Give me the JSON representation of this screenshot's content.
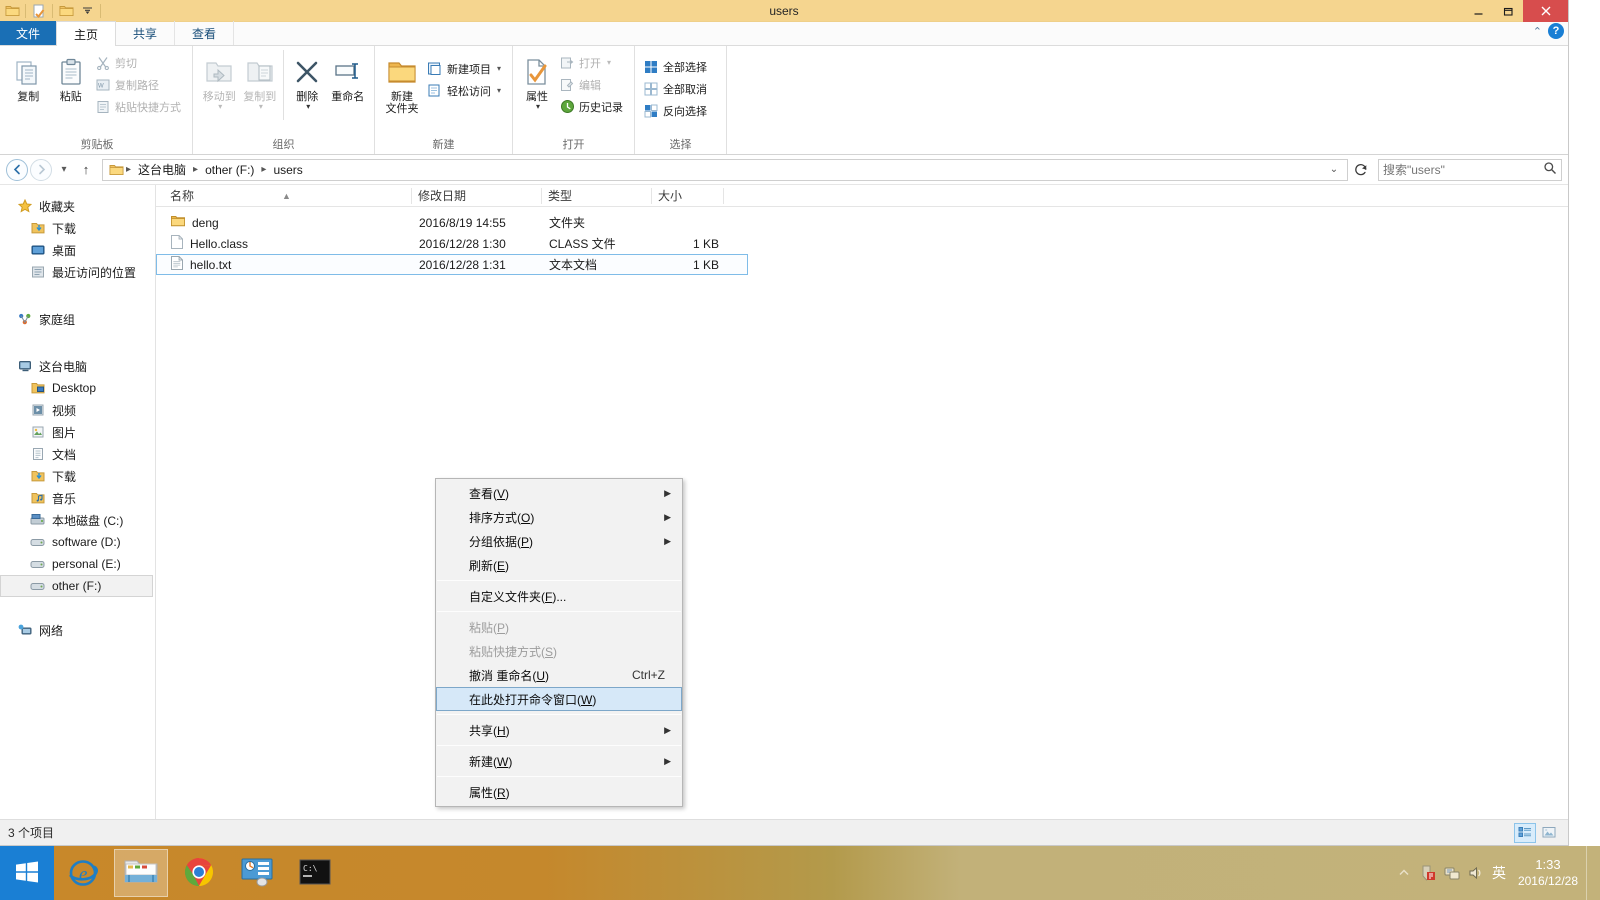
{
  "window": {
    "title": "users",
    "quick_access": [
      "folder-icon",
      "properties-icon",
      "new-folder-icon",
      "customize-dropdown"
    ],
    "minimize": "—",
    "maximize": "❐",
    "close": "✕"
  },
  "tabs": [
    {
      "label": "文件",
      "key": "file"
    },
    {
      "label": "主页",
      "key": "home"
    },
    {
      "label": "共享",
      "key": "share"
    },
    {
      "label": "查看",
      "key": "view"
    }
  ],
  "ribbon": {
    "groups": [
      {
        "label": "剪贴板",
        "big": [
          {
            "label": "复制",
            "icon": "copy-icon"
          },
          {
            "label": "粘贴",
            "icon": "paste-icon"
          }
        ],
        "small": [
          {
            "label": "剪切",
            "icon": "cut-icon",
            "disabled": true
          },
          {
            "label": "复制路径",
            "icon": "copy-path-icon",
            "disabled": true
          },
          {
            "label": "粘贴快捷方式",
            "icon": "paste-shortcut-icon",
            "disabled": true
          }
        ]
      },
      {
        "label": "组织",
        "big": [
          {
            "label": "移动到",
            "icon": "move-to-icon",
            "disabled": true,
            "dropdown": true
          },
          {
            "label": "复制到",
            "icon": "copy-to-icon",
            "disabled": true,
            "dropdown": true
          },
          {
            "label": "删除",
            "icon": "delete-icon",
            "dropdown": true
          },
          {
            "label": "重命名",
            "icon": "rename-icon"
          }
        ],
        "small": []
      },
      {
        "label": "新建",
        "big": [
          {
            "label": "新建\n文件夹",
            "icon": "new-folder-icon"
          }
        ],
        "small": [
          {
            "label": "新建项目",
            "icon": "new-item-icon",
            "dropdown": true
          },
          {
            "label": "轻松访问",
            "icon": "easy-access-icon",
            "dropdown": true
          }
        ]
      },
      {
        "label": "打开",
        "big": [
          {
            "label": "属性",
            "icon": "properties-icon",
            "dropdown": true
          }
        ],
        "small": [
          {
            "label": "打开",
            "icon": "open-icon",
            "disabled": true,
            "dropdown": true
          },
          {
            "label": "编辑",
            "icon": "edit-icon",
            "disabled": true
          },
          {
            "label": "历史记录",
            "icon": "history-icon"
          }
        ]
      },
      {
        "label": "选择",
        "big": [],
        "small": [
          {
            "label": "全部选择",
            "icon": "select-all-icon"
          },
          {
            "label": "全部取消",
            "icon": "select-none-icon"
          },
          {
            "label": "反向选择",
            "icon": "invert-selection-icon"
          }
        ]
      }
    ]
  },
  "address": {
    "back": "◀",
    "forward": "▶",
    "recent": "▾",
    "up": "↑",
    "crumbs": [
      "这台电脑",
      "other (F:)",
      "users"
    ],
    "separator": "▸",
    "dropdown": "⌄",
    "refresh": "↻"
  },
  "search": {
    "placeholder": "搜索\"users\"",
    "value": "",
    "icon": "search-icon"
  },
  "navpane": {
    "groups": [
      {
        "header": {
          "label": "收藏夹",
          "icon": "favorites-star-icon"
        },
        "items": [
          {
            "label": "下载",
            "icon": "downloads-icon"
          },
          {
            "label": "桌面",
            "icon": "desktop-icon"
          },
          {
            "label": "最近访问的位置",
            "icon": "recent-places-icon"
          }
        ]
      },
      {
        "header": {
          "label": "家庭组",
          "icon": "homegroup-icon"
        },
        "items": []
      },
      {
        "header": {
          "label": "这台电脑",
          "icon": "this-pc-icon"
        },
        "items": [
          {
            "label": "Desktop",
            "icon": "desktop-folder-icon"
          },
          {
            "label": "视频",
            "icon": "videos-icon"
          },
          {
            "label": "图片",
            "icon": "pictures-icon"
          },
          {
            "label": "文档",
            "icon": "documents-icon"
          },
          {
            "label": "下载",
            "icon": "downloads-icon"
          },
          {
            "label": "音乐",
            "icon": "music-icon"
          },
          {
            "label": "本地磁盘 (C:)",
            "icon": "system-drive-icon"
          },
          {
            "label": "software (D:)",
            "icon": "drive-icon"
          },
          {
            "label": "personal (E:)",
            "icon": "drive-icon"
          },
          {
            "label": "other (F:)",
            "icon": "drive-icon",
            "selected": true
          }
        ]
      },
      {
        "header": {
          "label": "网络",
          "icon": "network-icon"
        },
        "items": []
      }
    ]
  },
  "filelist": {
    "columns": [
      {
        "key": "name",
        "label": "名称",
        "sorted": "asc"
      },
      {
        "key": "date",
        "label": "修改日期"
      },
      {
        "key": "type",
        "label": "类型"
      },
      {
        "key": "size",
        "label": "大小"
      }
    ],
    "rows": [
      {
        "name": "deng",
        "date": "2016/8/19 14:55",
        "type": "文件夹",
        "size": "",
        "icon": "folder-icon",
        "selected": false
      },
      {
        "name": "Hello.class",
        "date": "2016/12/28 1:30",
        "type": "CLASS 文件",
        "size": "1 KB",
        "icon": "blank-file-icon",
        "selected": false
      },
      {
        "name": "hello.txt",
        "date": "2016/12/28 1:31",
        "type": "文本文档",
        "size": "1 KB",
        "icon": "text-file-icon",
        "selected": true
      }
    ]
  },
  "statusbar": {
    "item_count": "3 个项目",
    "views": [
      {
        "name": "details-view",
        "active": true
      },
      {
        "name": "large-icons-view",
        "active": false
      }
    ]
  },
  "context_menu": {
    "items": [
      {
        "label": "查看(V)",
        "text": "查看",
        "accesskey": "V",
        "submenu": true
      },
      {
        "label": "排序方式(O)",
        "text": "排序方式",
        "accesskey": "O",
        "submenu": true
      },
      {
        "label": "分组依据(P)",
        "text": "分组依据",
        "accesskey": "P",
        "submenu": true
      },
      {
        "label": "刷新(E)",
        "text": "刷新",
        "accesskey": "E"
      },
      {
        "separator": true
      },
      {
        "label": "自定义文件夹(F)...",
        "text": "自定义文件夹",
        "accesskey": "F",
        "suffix": "..."
      },
      {
        "separator": true
      },
      {
        "label": "粘贴(P)",
        "text": "粘贴",
        "accesskey": "P",
        "disabled": true
      },
      {
        "label": "粘贴快捷方式(S)",
        "text": "粘贴快捷方式",
        "accesskey": "S",
        "disabled": true
      },
      {
        "label": "撤消 重命名(U)",
        "text": "撤消 重命名",
        "accesskey": "U",
        "accel": "Ctrl+Z"
      },
      {
        "label": "在此处打开命令窗口(W)",
        "text": "在此处打开命令窗口",
        "accesskey": "W",
        "highlight": true
      },
      {
        "separator": true
      },
      {
        "label": "共享(H)",
        "text": "共享",
        "accesskey": "H",
        "submenu": true
      },
      {
        "separator": true
      },
      {
        "label": "新建(W)",
        "text": "新建",
        "accesskey": "W",
        "submenu": true
      },
      {
        "separator": true
      },
      {
        "label": "属性(R)",
        "text": "属性",
        "accesskey": "R"
      }
    ]
  },
  "taskbar": {
    "start": {
      "name": "start-button",
      "icon": "windows-logo-icon"
    },
    "items": [
      {
        "name": "taskbar-ie",
        "icon": "internet-explorer-icon",
        "active": false
      },
      {
        "name": "taskbar-explorer",
        "icon": "file-explorer-icon",
        "active": true
      },
      {
        "name": "taskbar-chrome",
        "icon": "chrome-icon",
        "active": false
      },
      {
        "name": "taskbar-control-panel",
        "icon": "control-panel-icon",
        "active": false
      },
      {
        "name": "taskbar-cmd",
        "icon": "command-prompt-icon",
        "active": false
      }
    ],
    "tray": {
      "icons": [
        "show-hidden-icons",
        "security-icon",
        "network-icon",
        "volume-icon"
      ],
      "ime": "英",
      "time": "1:33",
      "date": "2016/12/28"
    }
  },
  "colors": {
    "titlebar": "#f5d58f",
    "file_tab": "#1a6fb5",
    "selection_border": "#7fbce8",
    "ctx_highlight": "#d6e8f8",
    "taskbar_left": "#c8882a",
    "taskbar_right": "#c3b27a",
    "close_button": "#d74d4d"
  }
}
